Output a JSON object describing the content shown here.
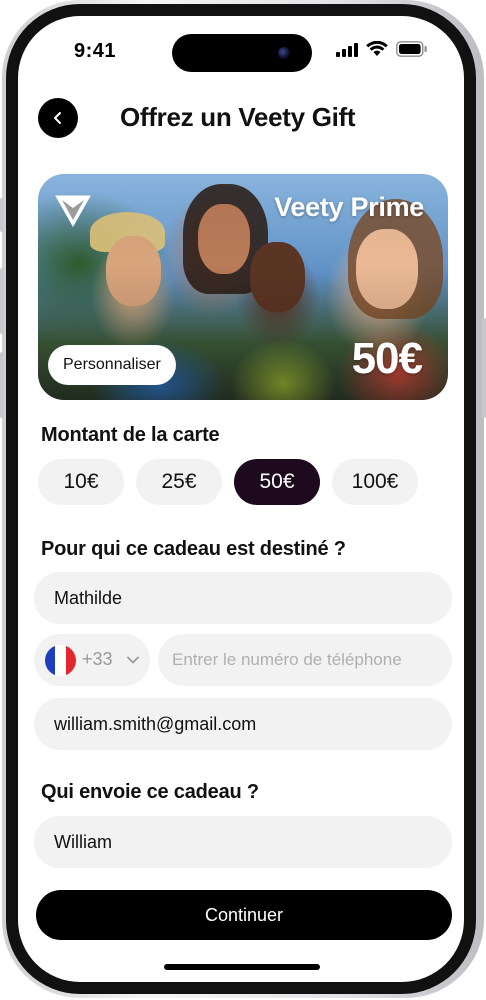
{
  "status_bar": {
    "time": "9:41",
    "icons": [
      "signal-icon",
      "wifi-icon",
      "battery-icon"
    ]
  },
  "header": {
    "back_icon": "chevron-left-icon",
    "title": "Offrez un Veety Gift"
  },
  "gift_card": {
    "logo_icon": "veety-logo-icon",
    "brand": "Veety Prime",
    "personalize_label": "Personnaliser",
    "amount": "50€"
  },
  "amount_section": {
    "label": "Montant de la carte",
    "options": [
      "10€",
      "25€",
      "50€",
      "100€"
    ],
    "selected": "50€"
  },
  "recipient_section": {
    "label": "Pour qui ce cadeau est destiné ?",
    "name_value": "Mathilde",
    "country": {
      "flag": "france-flag-icon",
      "code": "+33",
      "chevron": "chevron-down-icon",
      "flag_colors": [
        "#1d3fbd",
        "#ffffff",
        "#e4262f"
      ]
    },
    "phone_placeholder": "Entrer le numéro de téléphone",
    "email_value": "william.smith@gmail.com"
  },
  "sender_section": {
    "label": "Qui envoie ce cadeau ?",
    "name_value": "William"
  },
  "continue_label": "Continuer",
  "colors": {
    "selected_chip": "#1d0a1e",
    "field_bg": "#f2f2f2",
    "primary": "#000000"
  }
}
